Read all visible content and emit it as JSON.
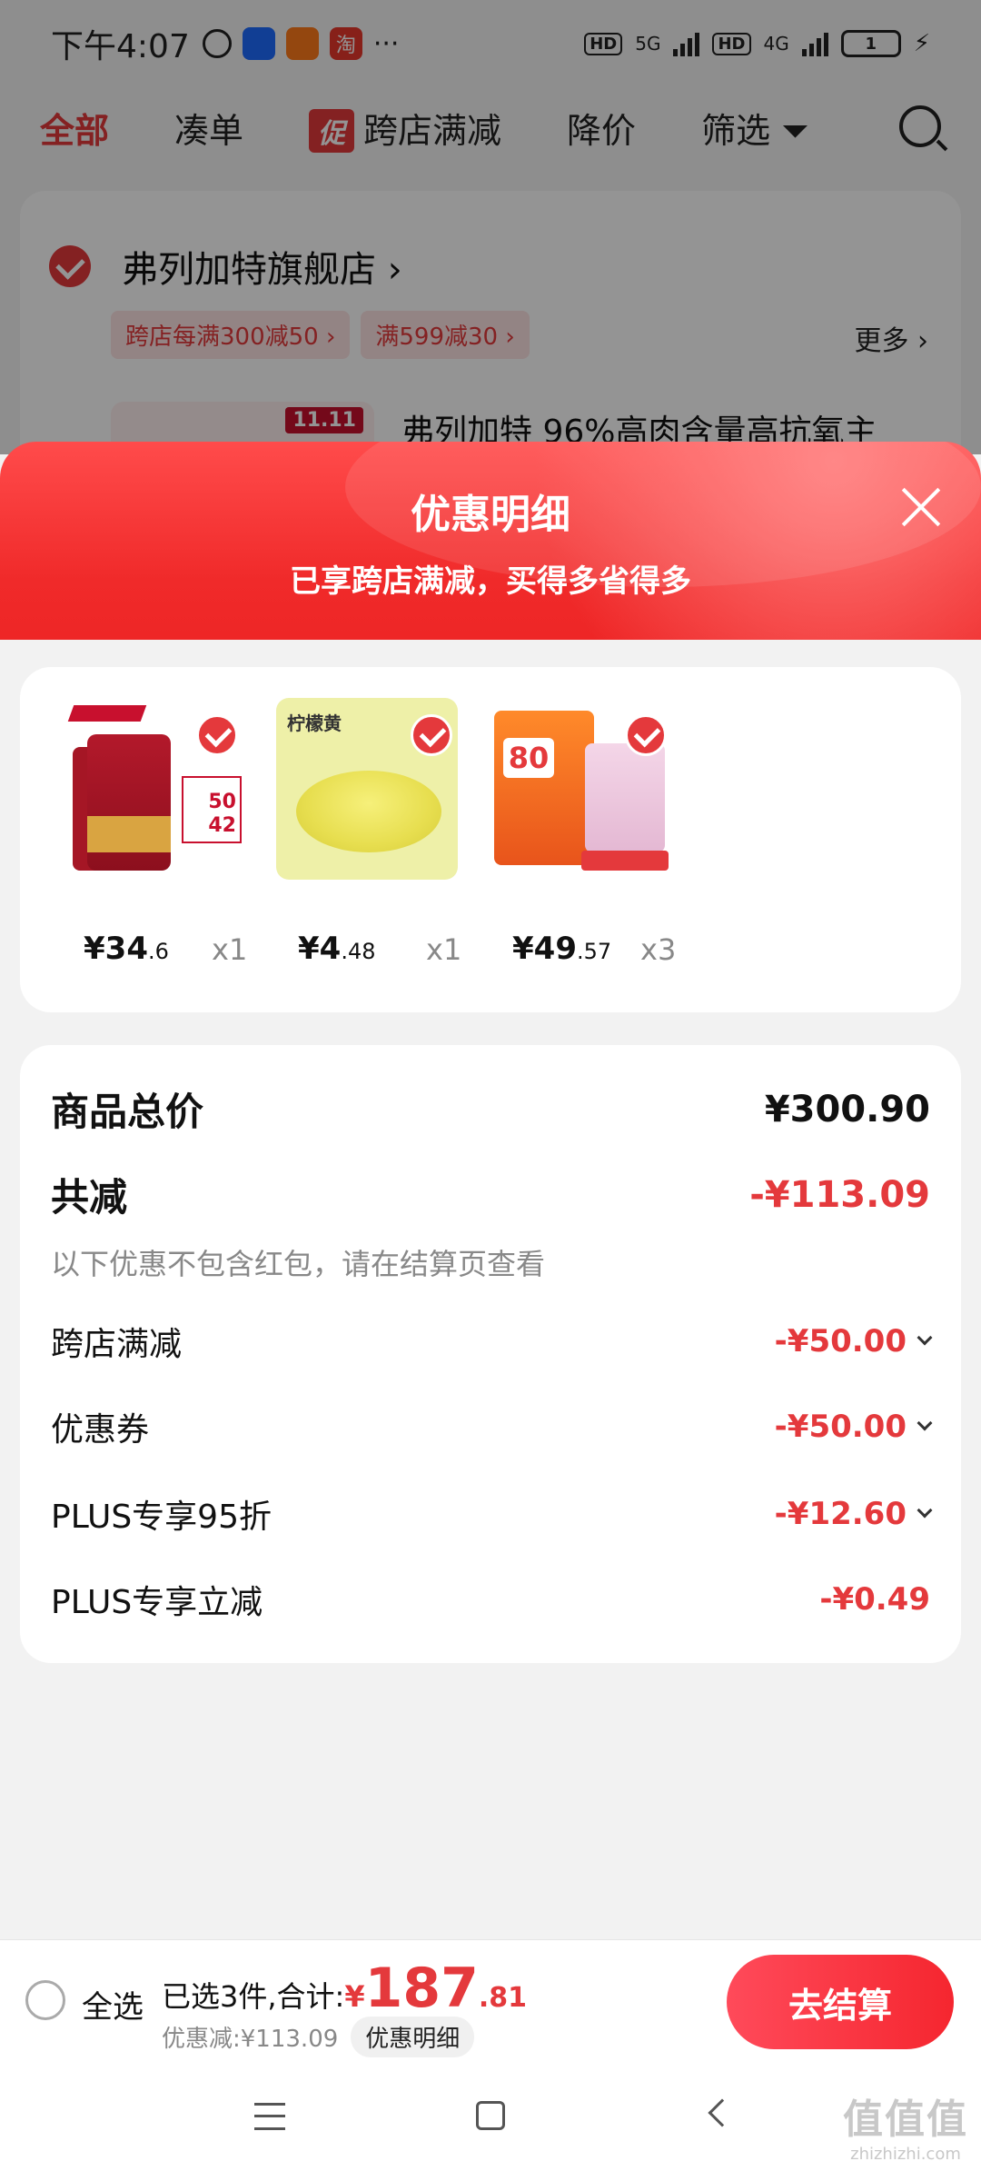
{
  "status_bar": {
    "time": "下午4:07",
    "app_icons": [
      "alarm-icon",
      "app-blue-icon",
      "app-orange-icon",
      "taobao-icon"
    ],
    "taobao_glyph": "淘",
    "more": "···",
    "network_1": "5G",
    "network_2": "4G",
    "hd": "HD",
    "battery": "1"
  },
  "top_tabs": {
    "all": "全部",
    "bundle": "凑单",
    "promo_badge": "促",
    "cross_store": "跨店满减",
    "price_drop": "降价",
    "filter": "筛选"
  },
  "store": {
    "name": "弗列加特旗舰店 ›",
    "coupons": [
      "跨店每满300减50 ›",
      "满599减30 ›"
    ],
    "more": "更多 ›",
    "product_title": "弗列加特 96%高肉含量高抗氧主"
  },
  "sheet": {
    "title": "优惠明细",
    "subtitle": "已享跨店满减，买得多省得多"
  },
  "items": [
    {
      "price_int": "¥34",
      "price_dec": ".6",
      "qty": "x1",
      "tag_top": "50",
      "tag_bottom": "42"
    },
    {
      "price_int": "¥4",
      "price_dec": ".48",
      "qty": "x1",
      "label": "柠檬黄"
    },
    {
      "price_int": "¥49",
      "price_dec": ".57",
      "qty": "x3",
      "badge": "80"
    }
  ],
  "summary": {
    "total_label": "商品总价",
    "total_value": "¥300.90",
    "discount_label": "共减",
    "discount_value": "-¥113.09",
    "note": "以下优惠不包含红包，请在结算页查看",
    "lines": [
      {
        "label": "跨店满减",
        "value": "-¥50.00"
      },
      {
        "label": "优惠券",
        "value": "-¥50.00"
      },
      {
        "label": "PLUS专享95折",
        "value": "-¥12.60"
      },
      {
        "label": "PLUS专享立减",
        "value": "-¥0.49"
      }
    ]
  },
  "bottom_bar": {
    "select_all": "全选",
    "selected_text": "已选3件,合计:",
    "currency": "¥",
    "total_int": "187",
    "total_dec": ".81",
    "discount_text": "优惠减:¥113.09",
    "detail_chip": "优惠明细",
    "checkout": "去结算"
  },
  "watermark": {
    "big": "值值值",
    "small": "zhizhizhi.com"
  },
  "colors": {
    "accent": "#e4393c",
    "header_gradient_top": "#ff4b4b",
    "header_gradient_bottom": "#ee2626"
  }
}
